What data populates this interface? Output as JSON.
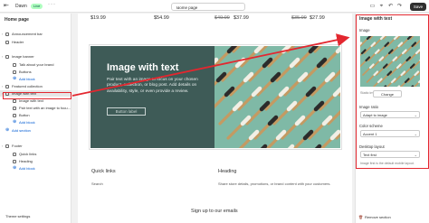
{
  "topbar": {
    "store_name": "Dawn",
    "live_badge": "Live",
    "page_select": "Home page",
    "save_label": "Save"
  },
  "sidebar": {
    "title": "Home page",
    "items": [
      {
        "label": "Announcement bar",
        "icon": "layout-icon",
        "level": 0,
        "chevron": true
      },
      {
        "label": "Header",
        "icon": "header-icon",
        "level": 0,
        "chevron": false
      },
      {
        "label": "Image banner",
        "icon": "image-icon",
        "level": 0,
        "chevron": true
      },
      {
        "label": "Talk about your brand",
        "icon": "text-icon",
        "level": 1
      },
      {
        "label": "Buttons",
        "icon": "button-icon",
        "level": 1
      },
      {
        "label": "Add block",
        "icon": "plus-icon",
        "level": 1,
        "add": true
      },
      {
        "label": "Featured collection",
        "icon": "collection-icon",
        "level": 0,
        "chevron": true
      },
      {
        "label": "Image with text",
        "icon": "image-text-icon",
        "level": 0,
        "chevron": true,
        "selected": true
      },
      {
        "label": "Image with text",
        "icon": "text-icon",
        "level": 1
      },
      {
        "label": "Pair text with an image to focu...",
        "icon": "text-icon",
        "level": 1
      },
      {
        "label": "Button",
        "icon": "button-icon",
        "level": 1
      },
      {
        "label": "Add block",
        "icon": "plus-icon",
        "level": 1,
        "add": true
      },
      {
        "label": "Add section",
        "icon": "plus-icon",
        "level": 0,
        "add": true
      },
      {
        "label": "Footer",
        "icon": "footer-icon",
        "level": 0,
        "chevron": true
      },
      {
        "label": "Quick links",
        "icon": "menu-icon",
        "level": 1
      },
      {
        "label": "Heading",
        "icon": "text-icon",
        "level": 1
      },
      {
        "label": "Add block",
        "icon": "plus-icon",
        "level": 1,
        "add": true
      }
    ],
    "footer_label": "Theme settings"
  },
  "preview": {
    "prices": [
      {
        "text": "$19.99",
        "strike": false
      },
      {
        "text": "$54.99",
        "strike": false
      },
      {
        "text": "$49.99",
        "strike": true
      },
      {
        "text": "$37.99",
        "strike": false
      },
      {
        "text": "$35.99",
        "strike": true
      },
      {
        "text": "$27.99",
        "strike": false
      }
    ],
    "image_with_text": {
      "title": "Image with text",
      "body": "Pair text with an image to focus on your chosen product, collection, or blog post. Add details on availability, style, or even provide a review.",
      "button": "Button label"
    },
    "footer": {
      "quick_links_title": "Quick links",
      "quick_links_item": "Search",
      "heading_title": "Heading",
      "heading_text": "Share store details, promotions, or brand content with your customers.",
      "signup": "Sign up to our emails"
    }
  },
  "settings_panel": {
    "title": "Image with text",
    "image_label": "Image",
    "image_caption": "Static image",
    "change_button": "Change",
    "height_label": "Image ratio",
    "height_value": "Adapt to image",
    "color_scheme_label": "Color scheme",
    "color_scheme_value": "Accent 1",
    "desktop_layout_label": "Desktop layout",
    "desktop_layout_value": "Text first",
    "help_text": "Image first is the default mobile layout.",
    "remove_label": "Remove section"
  },
  "colors": {
    "accent_red": "#e3272f",
    "panel_green": "#3e5b57",
    "live_green": "#affebf"
  }
}
